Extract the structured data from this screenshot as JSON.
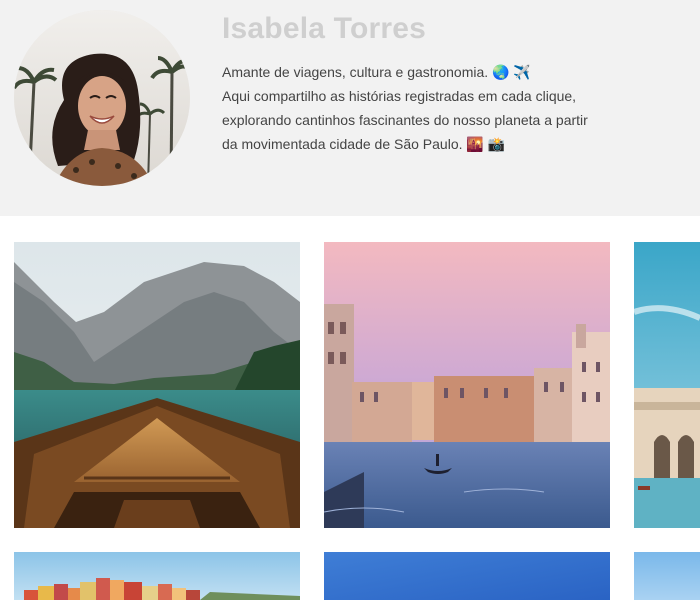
{
  "profile": {
    "name": "Isabela Torres",
    "bio_lines": [
      "Amante de viagens, cultura e gastronomia. 🌏 ✈️",
      "Aqui compartilho as histórias registradas em cada clique,",
      "explorando cantinhos fascinantes do nosso planeta a partir",
      "da movimentada cidade de São Paulo. 🌇 📸"
    ]
  },
  "colors": {
    "header_bg": "#f2f2f2",
    "name_color": "#cfcfcf",
    "bio_color": "#444444"
  },
  "gallery": {
    "photos": [
      {
        "subject": "mountain-lake-boat"
      },
      {
        "subject": "venice-canal-sunset"
      },
      {
        "subject": "coastal-town-arches"
      },
      {
        "subject": "colorful-hillside-village"
      },
      {
        "subject": "blue-sky"
      },
      {
        "subject": "blue-sky-edge"
      }
    ]
  }
}
